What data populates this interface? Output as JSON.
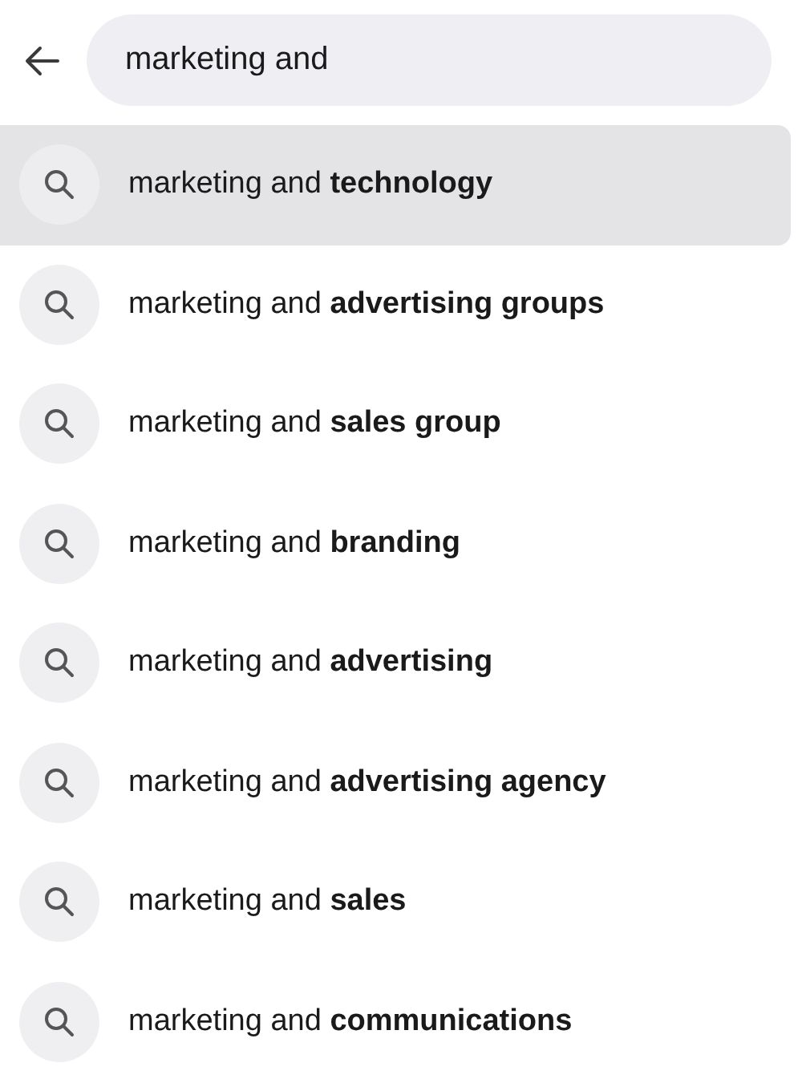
{
  "search": {
    "value": "marketing and"
  },
  "suggestions": [
    {
      "text": "marketing and **technology**",
      "selected": true
    },
    {
      "text": "marketing and **advertising groups**",
      "selected": false
    },
    {
      "text": "marketing and **sales group**",
      "selected": false
    },
    {
      "text": "marketing and **branding**",
      "selected": false
    },
    {
      "text": "marketing and **advertising**",
      "selected": false
    },
    {
      "text": "marketing and **advertising agency**",
      "selected": false
    },
    {
      "text": "marketing and **sales**",
      "selected": false
    },
    {
      "text": "marketing and **communications**",
      "selected": false
    }
  ]
}
